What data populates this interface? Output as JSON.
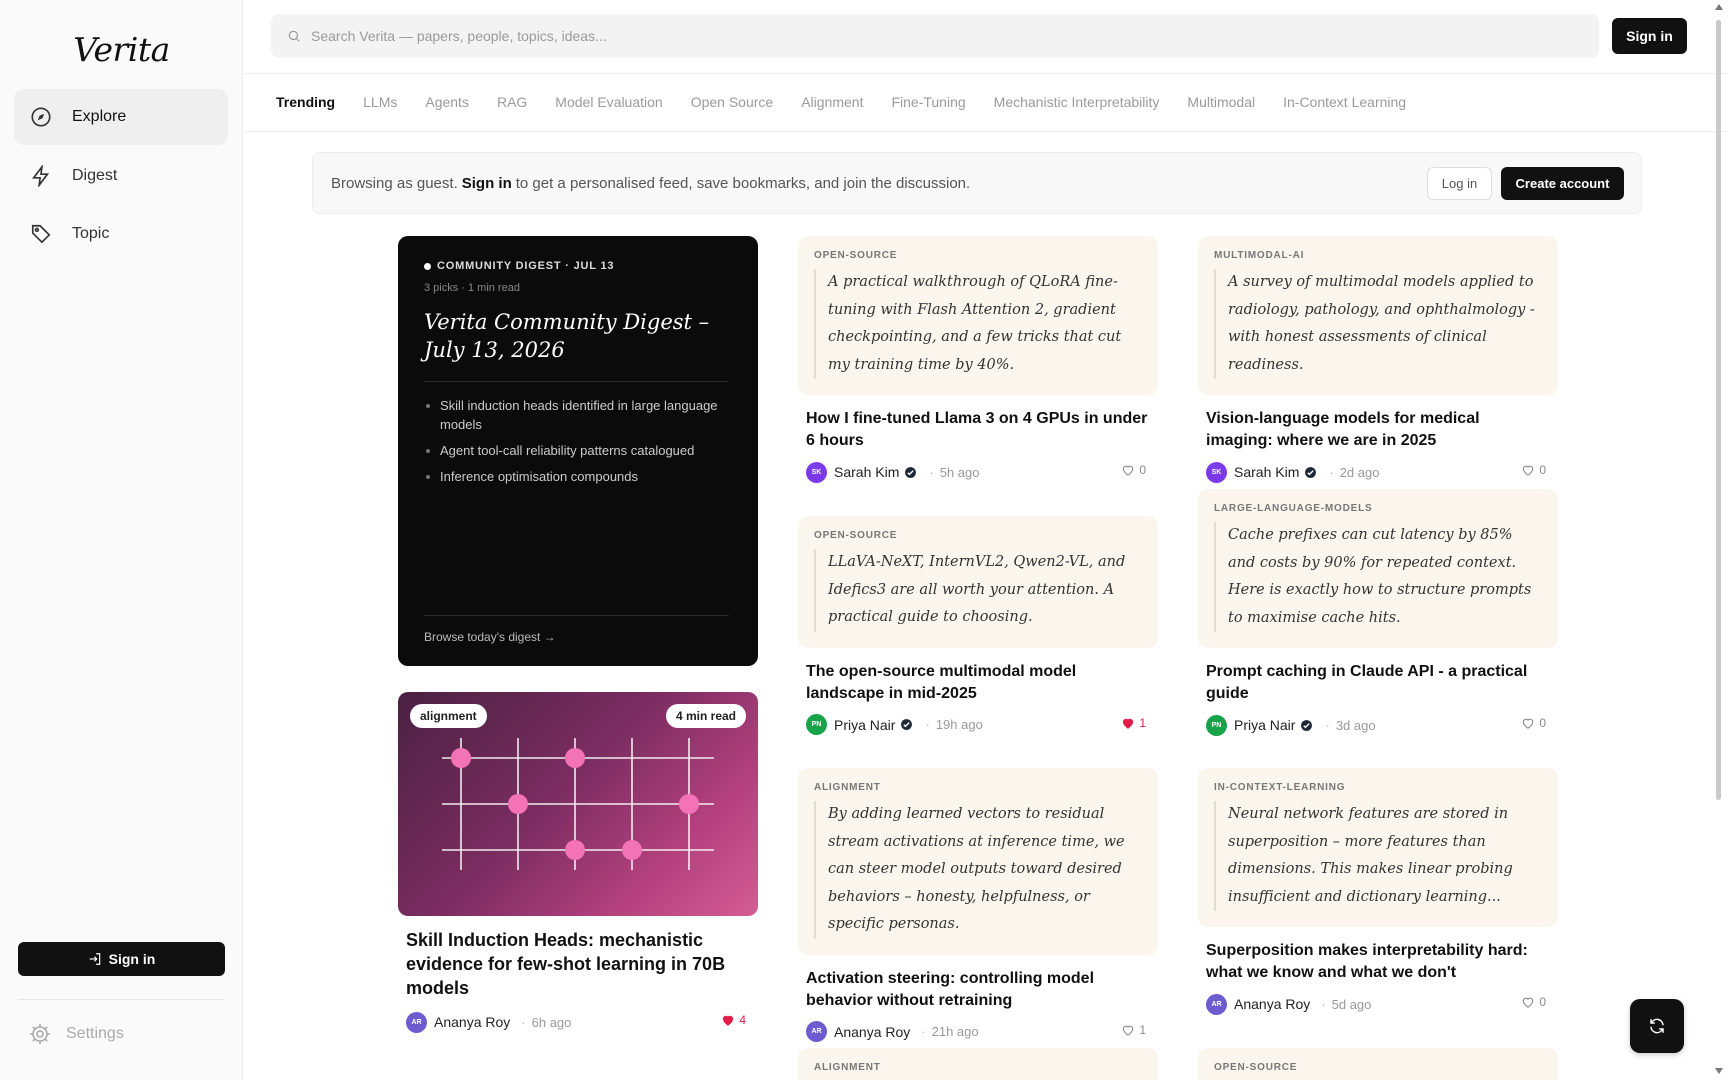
{
  "app": {
    "logo": "Verita"
  },
  "sidebar": {
    "items": [
      {
        "label": "Explore",
        "icon": "compass-icon"
      },
      {
        "label": "Digest",
        "icon": "lightning-icon"
      },
      {
        "label": "Topic",
        "icon": "tag-icon"
      }
    ],
    "signin_label": "Sign in",
    "settings_label": "Settings"
  },
  "topbar": {
    "search_placeholder": "Search Verita — papers, people, topics, ideas...",
    "signin_label": "Sign in"
  },
  "tabs": [
    "Trending",
    "LLMs",
    "Agents",
    "RAG",
    "Model Evaluation",
    "Open Source",
    "Alignment",
    "Fine-Tuning",
    "Mechanistic Interpretability",
    "Multimodal",
    "In-Context Learning"
  ],
  "banner": {
    "prefix": "Browsing as guest.",
    "link": "Sign in",
    "suffix": "to get a personalised feed, save bookmarks, and join the discussion.",
    "login_label": "Log in",
    "create_label": "Create account"
  },
  "digest": {
    "kicker": "COMMUNITY DIGEST · JUL 13",
    "meta": "3 picks · 1 min read",
    "title": "Verita Community Digest – July 13, 2026",
    "items": [
      "Skill induction heads identified in large language models",
      "Agent tool-call reliability patterns catalogued",
      "Inference optimisation compounds"
    ],
    "browse_label": "Browse today's digest →"
  },
  "image_post": {
    "tag": "alignment",
    "read_time": "4 min read",
    "title": "Skill Induction Heads: mechanistic evidence for few-shot learning in 70B models",
    "author": "Ananya Roy",
    "initials": "AR",
    "time": "6h ago",
    "likes": "4",
    "liked": true
  },
  "posts": [
    {
      "tag": "OPEN-SOURCE",
      "excerpt": "A practical walkthrough of QLoRA fine-tuning with Flash Attention 2, gradient checkpointing, and a few tricks that cut my training time by 40%.",
      "title": "How I fine-tuned Llama 3 on 4 GPUs in under 6 hours",
      "author": "Sarah Kim",
      "initials": "SK",
      "verified": true,
      "time": "5h ago",
      "likes": "0",
      "liked": false
    },
    {
      "tag": "MULTIMODAL-AI",
      "excerpt": "A survey of multimodal models applied to radiology, pathology, and ophthalmology - with honest assessments of clinical readiness.",
      "title": "Vision-language models for medical imaging: where we are in 2025",
      "author": "Sarah Kim",
      "initials": "SK",
      "verified": true,
      "time": "2d ago",
      "likes": "0",
      "liked": false
    },
    {
      "tag": "OPEN-SOURCE",
      "excerpt": "LLaVA-NeXT, InternVL2, Qwen2-VL, and Idefics3 are all worth your attention. A practical guide to choosing.",
      "title": "The open-source multimodal model landscape in mid-2025",
      "author": "Priya Nair",
      "initials": "PN",
      "verified": true,
      "time": "19h ago",
      "likes": "1",
      "liked": true
    },
    {
      "tag": "LARGE-LANGUAGE-MODELS",
      "excerpt": "Cache prefixes can cut latency by 85% and costs by 90% for repeated context. Here is exactly how to structure prompts to maximise cache hits.",
      "title": "Prompt caching in Claude API - a practical guide",
      "author": "Priya Nair",
      "initials": "PN",
      "verified": true,
      "time": "3d ago",
      "likes": "0",
      "liked": false
    },
    {
      "tag": "ALIGNMENT",
      "excerpt": "By adding learned vectors to residual stream activations at inference time, we can steer model outputs toward desired behaviors – honesty, helpfulness, or specific personas.",
      "title": "Activation steering: controlling model behavior without retraining",
      "author": "Ananya Roy",
      "initials": "AR",
      "verified": false,
      "time": "21h ago",
      "likes": "1",
      "liked": false
    },
    {
      "tag": "IN-CONTEXT-LEARNING",
      "excerpt": "Neural network features are stored in superposition – more features than dimensions. This makes linear probing insufficient and dictionary learning...",
      "title": "Superposition makes interpretability hard: what we know and what we don't",
      "author": "Ananya Roy",
      "initials": "AR",
      "verified": false,
      "time": "5d ago",
      "likes": "0",
      "liked": false
    },
    {
      "tag": "ALIGNMENT"
    },
    {
      "tag": "OPEN-SOURCE"
    }
  ],
  "colors": {
    "avatar_SK": "#7c3aed",
    "avatar_PN": "#16a34a",
    "avatar_AR": "#6d5bd0",
    "liked_heart": "#e11d48",
    "verified": "#1f2937"
  }
}
